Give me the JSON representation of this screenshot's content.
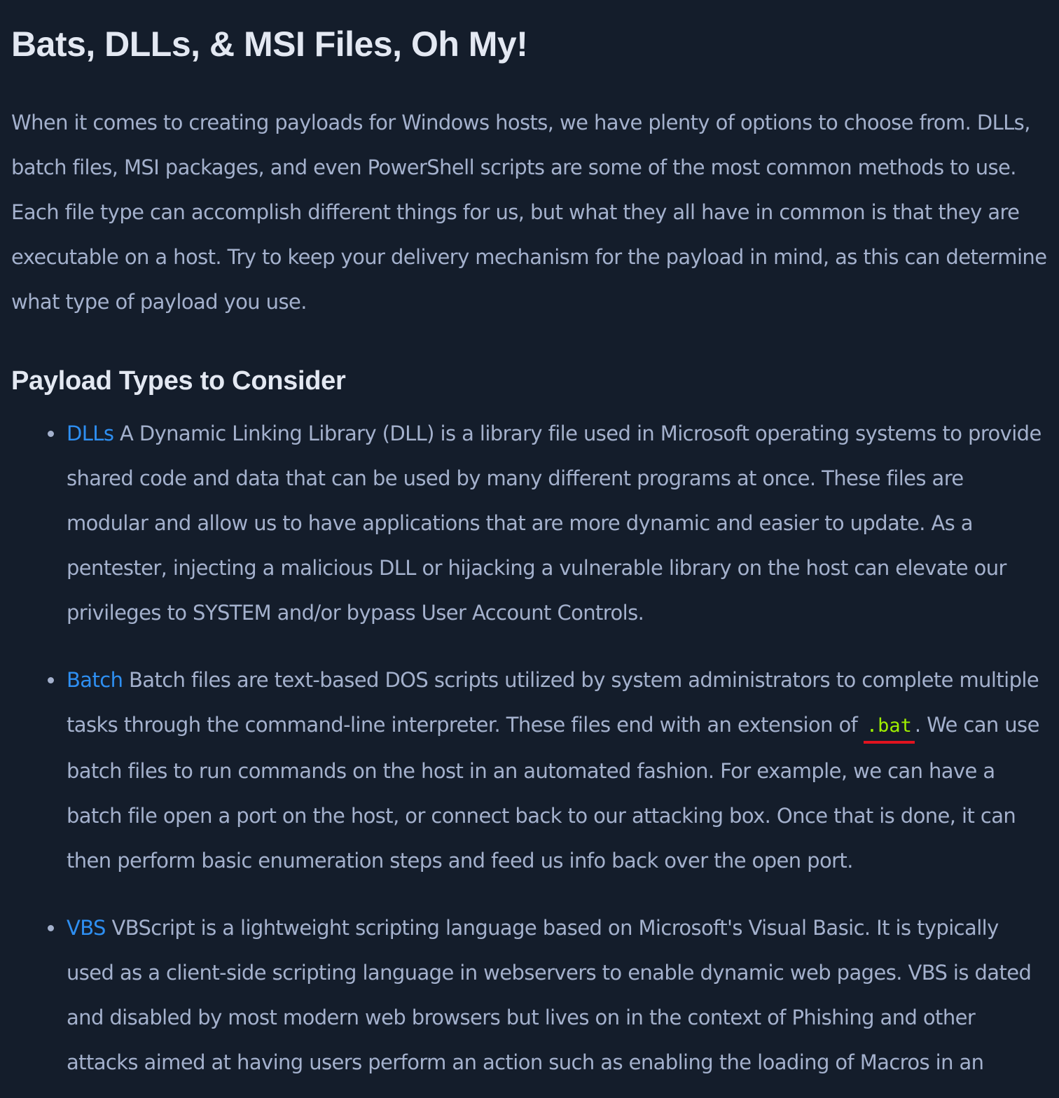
{
  "title": "Bats, DLLs, & MSI Files, Oh My!",
  "intro": "When it comes to creating payloads for Windows hosts, we have plenty of options to choose from. DLLs, batch files, MSI packages, and even PowerShell scripts are some of the most common methods to use. Each file type can accomplish different things for us, but what they all have in common is that they are executable on a host. Try to keep your delivery mechanism for the payload in mind, as this can determine what type of payload you use.",
  "section_heading": "Payload Types to Consider",
  "payloads": [
    {
      "term": "DLLs",
      "text": "A Dynamic Linking Library (DLL) is a library file used in Microsoft operating systems to provide shared code and data that can be used by many different programs at once. These files are modular and allow us to have applications that are more dynamic and easier to update. As a pentester, injecting a malicious DLL or hijacking a vulnerable library on the host can elevate our privileges to SYSTEM and/or bypass User Account Controls."
    },
    {
      "term": "Batch",
      "text_before": "Batch files are text-based DOS scripts utilized by system administrators to complete multiple tasks through the command-line interpreter. These files end with an extension of",
      "code": ".bat",
      "text_after": ". We can use batch files to run commands on the host in an automated fashion. For example, we can have a batch file open a port on the host, or connect back to our attacking box. Once that is done, it can then perform basic enumeration steps and feed us info back over the open port."
    },
    {
      "term": "VBS",
      "text": "VBScript is a lightweight scripting language based on Microsoft's Visual Basic. It is typically used as a client-side scripting language in webservers to enable dynamic web pages. VBS is dated and disabled by most modern web browsers but lives on in the context of Phishing and other attacks aimed at having users perform an action such as enabling the loading of Macros in an"
    }
  ],
  "colors": {
    "background": "#141d2b",
    "heading": "#e3e8f2",
    "body_text": "#a4b1cd",
    "link": "#2e8ff2",
    "code": "#9fef00",
    "code_underline": "#e1131f"
  }
}
